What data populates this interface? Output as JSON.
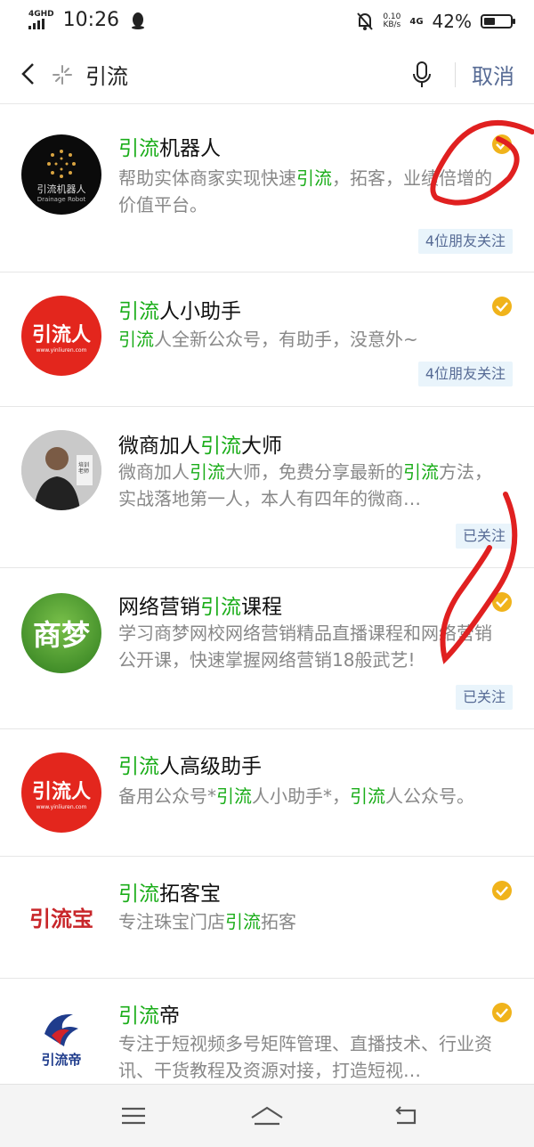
{
  "status": {
    "network": "4GHD",
    "time": "10:26",
    "speed_value": "0.10",
    "speed_unit": "KB/s",
    "net_type": "4G",
    "battery": "42%",
    "battery_level": 0.42
  },
  "search": {
    "query": "引流",
    "cancel_label": "取消"
  },
  "results": [
    {
      "title": [
        {
          "t": "引流",
          "h": true
        },
        {
          "t": "机器人",
          "h": false
        }
      ],
      "desc": [
        {
          "t": "帮助实体商家实现快速",
          "h": false
        },
        {
          "t": "引流",
          "h": true
        },
        {
          "t": "，拓客，业绩倍增的价值平台。",
          "h": false
        }
      ],
      "logo_text": "引流机器人",
      "logo_sub": "Drainage Robot",
      "verified": true,
      "tag": "4位朋友关注"
    },
    {
      "title": [
        {
          "t": "引流",
          "h": true
        },
        {
          "t": "人小助手",
          "h": false
        }
      ],
      "desc": [
        {
          "t": "引流",
          "h": true
        },
        {
          "t": "人全新公众号，有助手，没意外~",
          "h": false
        }
      ],
      "logo_text": "引流人",
      "logo_sub": "www.yinliuren.com",
      "verified": true,
      "tag": "4位朋友关注"
    },
    {
      "title": [
        {
          "t": "微商加人",
          "h": false
        },
        {
          "t": "引流",
          "h": true
        },
        {
          "t": "大师",
          "h": false
        }
      ],
      "desc": [
        {
          "t": "微商加人",
          "h": false
        },
        {
          "t": "引流",
          "h": true
        },
        {
          "t": "大师，免费分享最新的",
          "h": false
        },
        {
          "t": "引流",
          "h": true
        },
        {
          "t": "方法，实战落地第一人，本人有四年的微商…",
          "h": false
        }
      ],
      "logo_text": "培训老师",
      "logo_sub": "",
      "verified": false,
      "tag": "已关注"
    },
    {
      "title": [
        {
          "t": "网络营销",
          "h": false
        },
        {
          "t": "引流",
          "h": true
        },
        {
          "t": "课程",
          "h": false
        }
      ],
      "desc": [
        {
          "t": "学习商梦网校网络营销精品直播课程和网络营销公开课，快速掌握网络营销18般武艺!",
          "h": false
        }
      ],
      "logo_text": "商梦",
      "logo_sub": "",
      "verified": true,
      "tag": "已关注"
    },
    {
      "title": [
        {
          "t": "引流",
          "h": true
        },
        {
          "t": "人高级助手",
          "h": false
        }
      ],
      "desc": [
        {
          "t": "备用公众号*",
          "h": false
        },
        {
          "t": "引流",
          "h": true
        },
        {
          "t": "人小助手*，",
          "h": false
        },
        {
          "t": "引流",
          "h": true
        },
        {
          "t": "人公众号。",
          "h": false
        }
      ],
      "logo_text": "引流人",
      "logo_sub": "www.yinliuren.com",
      "verified": false,
      "tag": ""
    },
    {
      "title": [
        {
          "t": "引流",
          "h": true
        },
        {
          "t": "拓客宝",
          "h": false
        }
      ],
      "desc": [
        {
          "t": "专注珠宝门店",
          "h": false
        },
        {
          "t": "引流",
          "h": true
        },
        {
          "t": "拓客",
          "h": false
        }
      ],
      "logo_text": "引流宝",
      "logo_sub": "",
      "verified": true,
      "tag": ""
    },
    {
      "title": [
        {
          "t": "引流",
          "h": true
        },
        {
          "t": "帝",
          "h": false
        }
      ],
      "desc": [
        {
          "t": "专注于短视频多号矩阵管理、直播技术、行业资讯、干货教程及资源对接，打造短视…",
          "h": false
        }
      ],
      "logo_text": "引流帝",
      "logo_sub": "",
      "verified": true,
      "tag": ""
    }
  ],
  "colors": {
    "highlight": "#1aad19",
    "link": "#576b95",
    "tag_bg": "#e9f4fb",
    "verified": "#f0b31b",
    "annotation": "#e02020"
  }
}
